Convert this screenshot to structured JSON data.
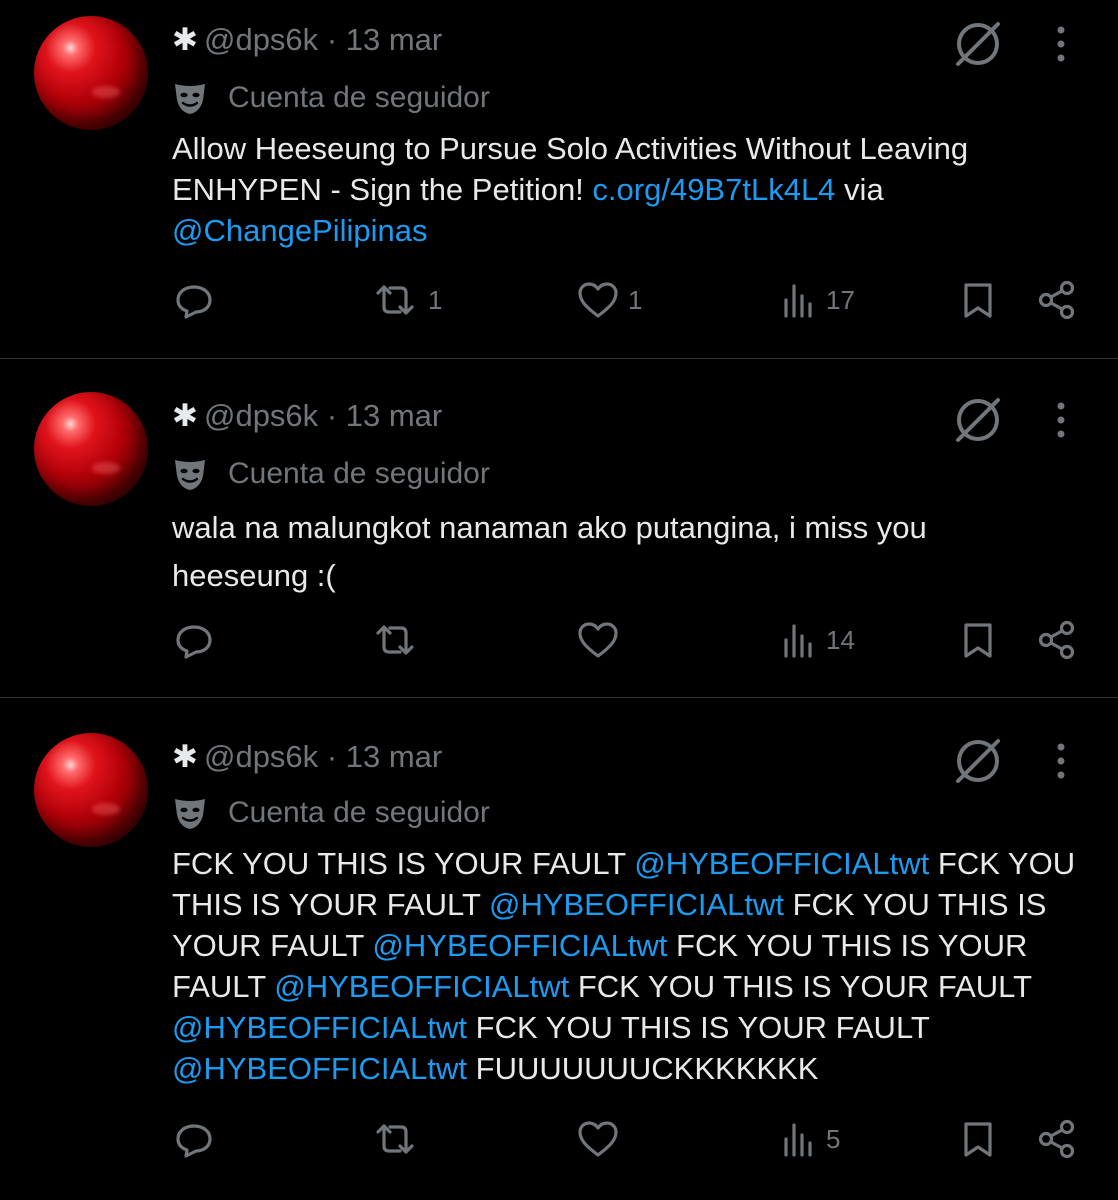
{
  "tweets": [
    {
      "handle": "@dps6k",
      "separator": "·",
      "date": "13 mar",
      "follower_label": "Cuenta de seguidor",
      "text_parts": [
        {
          "text": "Allow Heeseung to Pursue Solo Activities Without Leaving ENHYPEN - Sign the Petition! ",
          "link": false
        },
        {
          "text": "c.org/49B7tLk4L4",
          "link": true
        },
        {
          "text": " via ",
          "link": false
        },
        {
          "text": "@ChangePilipinas",
          "link": true
        }
      ],
      "retweets": "1",
      "likes": "1",
      "views": "17"
    },
    {
      "handle": "@dps6k",
      "separator": "·",
      "date": "13 mar",
      "follower_label": "Cuenta de seguidor",
      "text_parts": [
        {
          "text": "wala na malungkot nanaman ako putangina, i miss you heeseung :(",
          "link": false
        }
      ],
      "retweets": "",
      "likes": "",
      "views": "14"
    },
    {
      "handle": "@dps6k",
      "separator": "·",
      "date": "13 mar",
      "follower_label": "Cuenta de seguidor",
      "text_parts": [
        {
          "text": "FCK YOU THIS IS YOUR FAULT ",
          "link": false
        },
        {
          "text": "@HYBEOFFICIALtwt",
          "link": true
        },
        {
          "text": " FCK YOU THIS IS YOUR FAULT ",
          "link": false
        },
        {
          "text": "@HYBEOFFICIALtwt",
          "link": true
        },
        {
          "text": " FCK YOU THIS IS YOUR FAULT ",
          "link": false
        },
        {
          "text": "@HYBEOFFICIALtwt",
          "link": true
        },
        {
          "text": " FCK YOU THIS IS YOUR FAULT ",
          "link": false
        },
        {
          "text": "@HYBEOFFICIALtwt",
          "link": true
        },
        {
          "text": " FCK YOU THIS IS YOUR FAULT ",
          "link": false
        },
        {
          "text": "@HYBEOFFICIALtwt",
          "link": true
        },
        {
          "text": " FCK YOU THIS IS YOUR FAULT ",
          "link": false
        },
        {
          "text": "@HYBEOFFICIALtwt",
          "link": true
        },
        {
          "text": " FUUUUUUUCKKKKKKK",
          "link": false
        }
      ],
      "retweets": "",
      "likes": "",
      "views": "5"
    }
  ],
  "icons": {
    "verified_asterisk": "asterisk-icon",
    "grok": "grok-icon",
    "more": "more-options-icon",
    "follower": "follower-mask-icon",
    "reply": "reply-icon",
    "retweet": "retweet-icon",
    "like": "like-icon",
    "views": "views-icon",
    "bookmark": "bookmark-icon",
    "share": "share-icon"
  },
  "colors": {
    "background": "#000000",
    "text": "#e7e9ea",
    "muted": "#71767b",
    "link": "#1d9bf0",
    "divider": "#2f3336"
  }
}
